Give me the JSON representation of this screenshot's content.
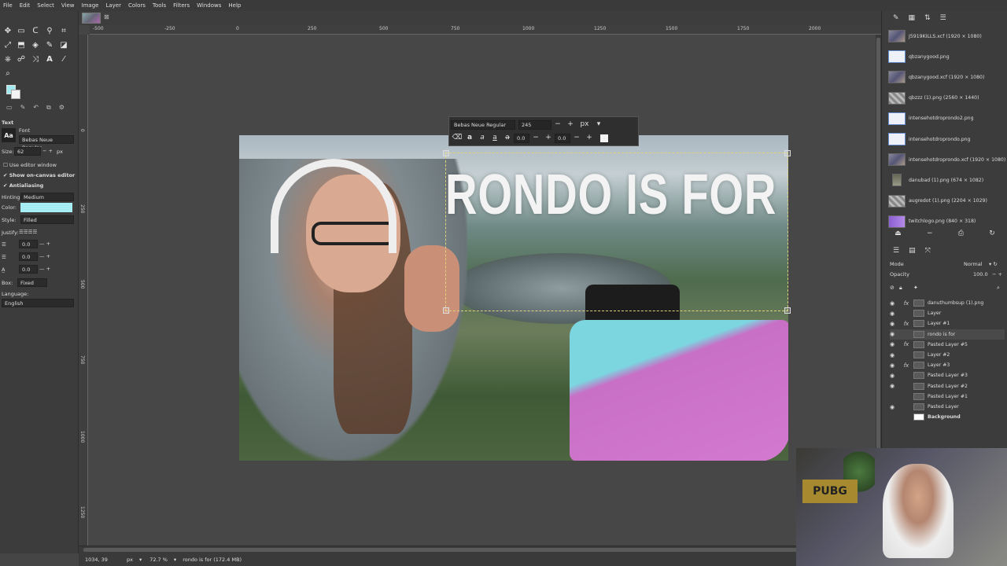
{
  "menu": [
    "File",
    "Edit",
    "Select",
    "View",
    "Image",
    "Layer",
    "Colors",
    "Tools",
    "Filters",
    "Windows",
    "Help"
  ],
  "toolbox": {
    "section_title": "Text",
    "font_label": "Font",
    "font_value": "Bebas Neue Regular",
    "size_label": "Size:",
    "size_value": "62",
    "size_unit": "px",
    "use_editor": "Use editor window",
    "show_canvas": "Show on-canvas editor",
    "antialiasing": "Antialiasing",
    "hinting_label": "Hinting:",
    "hinting_value": "Medium",
    "color_label": "Color:",
    "color_value": "#a6eef3",
    "style_label": "Style:",
    "style_value": "Filled",
    "justify_label": "Justify:",
    "indent_value": "0.0",
    "line_spacing_value": "0.0",
    "letter_spacing_value": "0.0",
    "box_label": "Box:",
    "box_value": "Fixed",
    "language_label": "Language:",
    "language_value": "English"
  },
  "ruler": {
    "h_ticks": [
      "-500",
      "-250",
      "0",
      "250",
      "500",
      "750",
      "1000",
      "1250",
      "1500",
      "1750",
      "2000"
    ],
    "v_ticks": [
      "0",
      "250",
      "500",
      "750",
      "1000",
      "1250"
    ]
  },
  "canvas": {
    "title_text": "RONDO IS FOR"
  },
  "text_editor": {
    "font": "Bebas Neue Regular",
    "size": "245",
    "unit": "px",
    "baseline": "0.0",
    "kerning": "0.0"
  },
  "images_panel": {
    "items": [
      {
        "label": "J5919KILLS.xcf (1920 × 1080)",
        "thumb": "photo"
      },
      {
        "label": "qbzanygood.png",
        "thumb": "doc"
      },
      {
        "label": "qbzanygood.xcf (1920 × 1080)",
        "thumb": "photo"
      },
      {
        "label": "qbzzz (1).png (2560 × 1440)",
        "thumb": "check"
      },
      {
        "label": "intensehotdroprondo2.png",
        "thumb": "doc"
      },
      {
        "label": "intensehotdroprondo.png",
        "thumb": "doc"
      },
      {
        "label": "intensehotdroprondo.xcf (1920 × 1080)",
        "thumb": "photo"
      },
      {
        "label": "danubad (1).png (674 × 1082)",
        "thumb": "person"
      },
      {
        "label": "augredot (1).png (2204 × 1029)",
        "thumb": "check"
      },
      {
        "label": "twitchlogo.png (840 × 318)",
        "thumb": "purple"
      }
    ]
  },
  "layers_panel": {
    "mode_label": "Mode",
    "mode_value": "Normal",
    "opacity_label": "Opacity",
    "opacity_value": "100.0",
    "layers": [
      {
        "name": "danuthumbsup (1).png",
        "eye": true,
        "fx": true
      },
      {
        "name": "Layer",
        "eye": true,
        "fx": false
      },
      {
        "name": "Layer #1",
        "eye": true,
        "fx": true
      },
      {
        "name": "rondo is for",
        "eye": true,
        "fx": false,
        "selected": true
      },
      {
        "name": "Pasted Layer #5",
        "eye": true,
        "fx": true
      },
      {
        "name": "Layer #2",
        "eye": true,
        "fx": false
      },
      {
        "name": "Layer #3",
        "eye": true,
        "fx": true
      },
      {
        "name": "Pasted Layer #3",
        "eye": true,
        "fx": false
      },
      {
        "name": "Pasted Layer #2",
        "eye": true,
        "fx": false
      },
      {
        "name": "Pasted Layer #1",
        "eye": false,
        "fx": false
      },
      {
        "name": "Pasted Layer",
        "eye": true,
        "fx": false
      },
      {
        "name": "Background",
        "eye": false,
        "fx": false,
        "bold": true
      }
    ]
  },
  "webcam": {
    "poster_text": "PUBG"
  },
  "status": {
    "coords": "1034, 39",
    "unit": "px",
    "zoom": "72.7 %",
    "message": "rondo is for (172.4 MB)"
  }
}
